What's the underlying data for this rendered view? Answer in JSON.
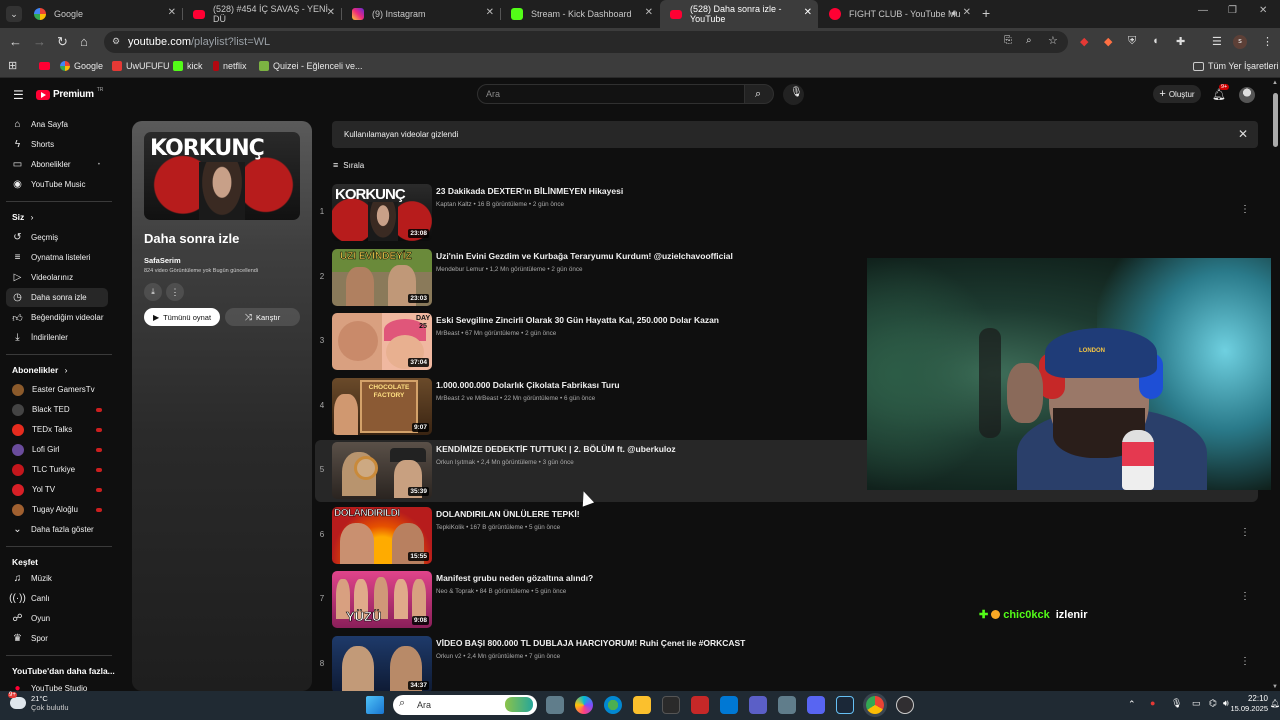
{
  "colors": {
    "brand_red": "#ff0033",
    "bg": "#0f0f0f",
    "accent_green": "#53fc18"
  },
  "browser": {
    "tabs": [
      {
        "label": "Google",
        "icon": "google-icon"
      },
      {
        "label": "(528) #454 İÇ SAVAŞ - YENİ DÜ",
        "icon": "youtube-icon"
      },
      {
        "label": "(9) Instagram",
        "icon": "instagram-icon"
      },
      {
        "label": "Stream - Kick Dashboard",
        "icon": "kick-icon"
      },
      {
        "label": "(528) Daha sonra izle - YouTube",
        "icon": "youtube-icon"
      },
      {
        "label": "FIGHT CLUB - YouTube Mu",
        "icon": "youtube-music-icon"
      }
    ],
    "url_host": "youtube.com",
    "url_path": "/playlist?list=WL",
    "bookmarks": [
      "Google",
      "UwUFUFU",
      "kick",
      "netflix",
      "Quizei - Eğlenceli ve..."
    ],
    "all_bookmarks": "Tüm Yer İşaretleri",
    "profile_initial": "s"
  },
  "yt_header": {
    "logo": "Premium",
    "logo_region": "TR",
    "search_placeholder": "Ara",
    "create_label": "Oluştur",
    "notif_count": "9+"
  },
  "sidebar": {
    "main": [
      {
        "label": "Ana Sayfa",
        "icon": "home-icon"
      },
      {
        "label": "Shorts",
        "icon": "shorts-icon"
      },
      {
        "label": "Abonelikler",
        "icon": "subscriptions-icon"
      },
      {
        "label": "YouTube Music",
        "icon": "music-icon"
      }
    ],
    "you_heading": "Siz",
    "you": [
      {
        "label": "Geçmiş",
        "icon": "history-icon"
      },
      {
        "label": "Oynatma listeleri",
        "icon": "playlists-icon"
      },
      {
        "label": "Videolarınız",
        "icon": "your-videos-icon"
      },
      {
        "label": "Daha sonra izle",
        "icon": "watch-later-icon"
      },
      {
        "label": "Beğendiğim videolar",
        "icon": "like-icon"
      },
      {
        "label": "İndirilenler",
        "icon": "download-icon"
      }
    ],
    "subs_heading": "Abonelikler",
    "subs": [
      {
        "label": "Easter GamersTv",
        "color": "#8b5a2b"
      },
      {
        "label": "Black TED",
        "color": "#333333"
      },
      {
        "label": "TEDx Talks",
        "color": "#e62b1e"
      },
      {
        "label": "Lofi Girl",
        "color": "#6a4c9c"
      },
      {
        "label": "TLC Turkiye",
        "color": "#c4161c"
      },
      {
        "label": "Yol TV",
        "color": "#d81f26"
      },
      {
        "label": "Tugay Aloğlu",
        "color": "#a06030"
      }
    ],
    "show_more": "Daha fazla göster",
    "explore_heading": "Keşfet",
    "explore": [
      {
        "label": "Müzik",
        "icon": "music-note-icon"
      },
      {
        "label": "Canlı",
        "icon": "live-icon"
      },
      {
        "label": "Oyun",
        "icon": "gaming-icon"
      },
      {
        "label": "Spor",
        "icon": "trophy-icon"
      }
    ],
    "more_heading": "YouTube'dan daha fazla...",
    "studio": "YouTube Studio"
  },
  "playlist": {
    "title": "Daha sonra izle",
    "owner": "SafaSerim",
    "meta": "824 video  Görüntüleme yok  Bugün güncellendi",
    "thumb_text": "KORKUNÇ",
    "play_all": "Tümünü oynat",
    "shuffle": "Karıştır"
  },
  "list": {
    "hidden_notice": "Kullanılamayan videolar gizlendi",
    "sort": "Sırala",
    "videos": [
      {
        "num": "1",
        "title": "23 Dakikada DEXTER'ın BİLİNMEYEN Hikayesi",
        "meta": "Kaptan Kaltz • 16 B görüntüleme • 2 gün önce",
        "dur": "23:08",
        "thumb_text": "KORKUNÇ"
      },
      {
        "num": "2",
        "title": "Uzi'nin Evini Gezdim ve Kurbağa Teraryumu Kurdum! @uzielchavoofficial",
        "meta": "Mendebur Lemur • 1,2 Mn görüntüleme • 2 gün önce",
        "dur": "23:03",
        "thumb_text": "UZI EVİNDEYİZ"
      },
      {
        "num": "3",
        "title": "Eski Sevgiline Zincirli Olarak 30 Gün Hayatta Kal, 250.000 Dolar Kazan",
        "meta": "MrBeast • 67 Mn görüntüleme • 2 gün önce",
        "dur": "37:04",
        "thumb_text": "DAY 25"
      },
      {
        "num": "4",
        "title": "1.000.000.000 Dolarlık Çikolata Fabrikası Turu",
        "meta": "MrBeast 2 ve MrBeast • 22 Mn görüntüleme • 6 gün önce",
        "dur": "9:07",
        "thumb_text": "CHOCOLATE FACTORY"
      },
      {
        "num": "5",
        "title": "KENDİMİZE DEDEKTİF TUTTUK! | 2. BÖLÜM ft. @uberkuloz",
        "meta": "Orkun Işıtmak • 2,4 Mn görüntüleme • 3 gün önce",
        "dur": "35:39",
        "thumb_text": ""
      },
      {
        "num": "6",
        "title": "DOLANDIRILAN ÜNLÜLERE TEPKİ!",
        "meta": "TepkiKolik • 167 B görüntüleme • 5 gün önce",
        "dur": "15:55",
        "thumb_text": "DOLANDIRILDI"
      },
      {
        "num": "7",
        "title": "Manifest grubu neden gözaltına alındı?",
        "meta": "Neo & Toprak • 84 B görüntüleme • 5 gün önce",
        "dur": "9:08",
        "thumb_text": "YÜZÜ"
      },
      {
        "num": "8",
        "title": "VİDEO BAŞI 800.000 TL DUBLAJA HARCIYORUM! Ruhi Çenet ile #ORKCAST",
        "meta": "Orkun v2 • 2,4 Mn görüntüleme • 7 gün önce",
        "dur": "34:37",
        "thumb_text": ""
      }
    ]
  },
  "overlay": {
    "follower_name": "chic0kck",
    "follower_action": "izlenir",
    "cap_text": "LONDON"
  },
  "taskbar": {
    "weather_temp": "21°C",
    "weather_desc": "Çok bulutlu",
    "search": "Ara",
    "time": "22:10",
    "date": "15.09.2025"
  }
}
